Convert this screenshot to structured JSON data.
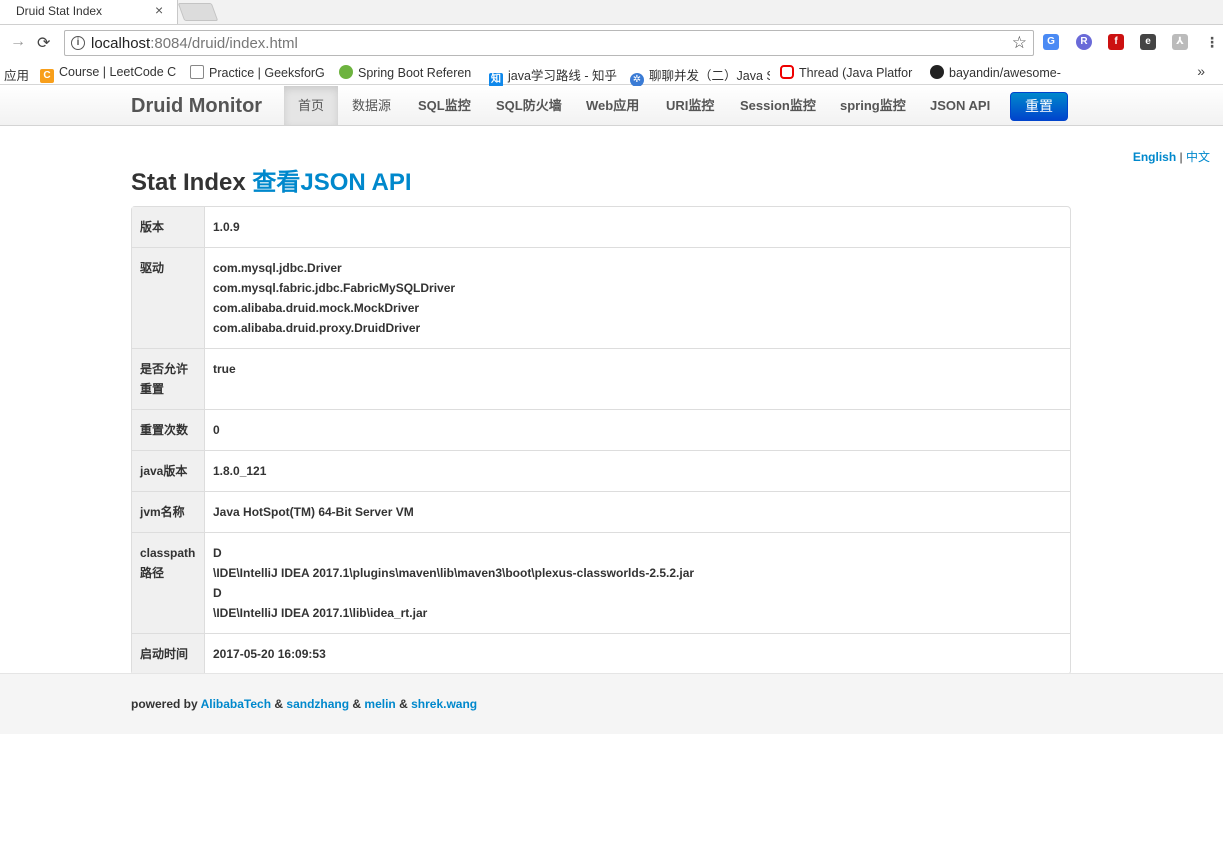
{
  "browser": {
    "tab_title": "Druid Stat Index",
    "tab_close": "×",
    "url_host": "localhost",
    "url_rest": ":8084/druid/index.html",
    "bookmarks": [
      {
        "label": "应用",
        "icon": "apps-icon"
      },
      {
        "label": "Course | LeetCode C",
        "icon": "leetcode-icon"
      },
      {
        "label": "Practice | GeeksforG",
        "icon": "page-icon"
      },
      {
        "label": "Spring Boot Referen",
        "icon": "spring-icon"
      },
      {
        "label": "java学习路线 - 知乎",
        "icon": "zhihu-icon"
      },
      {
        "label": "聊聊并发（二）Java S",
        "icon": "gear-icon"
      },
      {
        "label": "Thread (Java Platfor",
        "icon": "oracle-icon"
      },
      {
        "label": "bayandin/awesome-",
        "icon": "github-icon"
      }
    ],
    "bookmarks_more": "»"
  },
  "navbar": {
    "brand": "Druid Monitor",
    "items": [
      "首页",
      "数据源",
      "SQL监控",
      "SQL防火墙",
      "Web应用",
      "URI监控",
      "Session监控",
      "spring监控",
      "JSON API"
    ],
    "reset_label": "重置"
  },
  "lang": {
    "english": "English",
    "sep": " | ",
    "chinese": "中文"
  },
  "page": {
    "title_prefix": "Stat Index ",
    "title_link": "查看JSON API"
  },
  "stats": {
    "rows": [
      {
        "key": "版本",
        "values": [
          "1.0.9"
        ]
      },
      {
        "key": "驱动",
        "values": [
          "com.mysql.jdbc.Driver",
          "com.mysql.fabric.jdbc.FabricMySQLDriver",
          "com.alibaba.druid.mock.MockDriver",
          "com.alibaba.druid.proxy.DruidDriver"
        ]
      },
      {
        "key": "是否允许重置",
        "values": [
          "true"
        ]
      },
      {
        "key": "重置次数",
        "values": [
          "0"
        ]
      },
      {
        "key": "java版本",
        "values": [
          "1.8.0_121"
        ]
      },
      {
        "key": "jvm名称",
        "values": [
          "Java HotSpot(TM) 64-Bit Server VM"
        ]
      },
      {
        "key": "classpath路径",
        "values": [
          "D",
          "\\IDE\\IntelliJ IDEA 2017.1\\plugins\\maven\\lib\\maven3\\boot\\plexus-classworlds-2.5.2.jar",
          "D",
          "\\IDE\\IntelliJ IDEA 2017.1\\lib\\idea_rt.jar"
        ]
      },
      {
        "key": "启动时间",
        "values": [
          "2017-05-20 16:09:53"
        ]
      }
    ]
  },
  "footer": {
    "prefix": "powered by ",
    "links": [
      "AlibabaTech",
      "sandzhang",
      "melin",
      "shrek.wang"
    ],
    "sep": " & "
  },
  "colors": {
    "link": "#0088cc",
    "button": "#0055cc"
  }
}
